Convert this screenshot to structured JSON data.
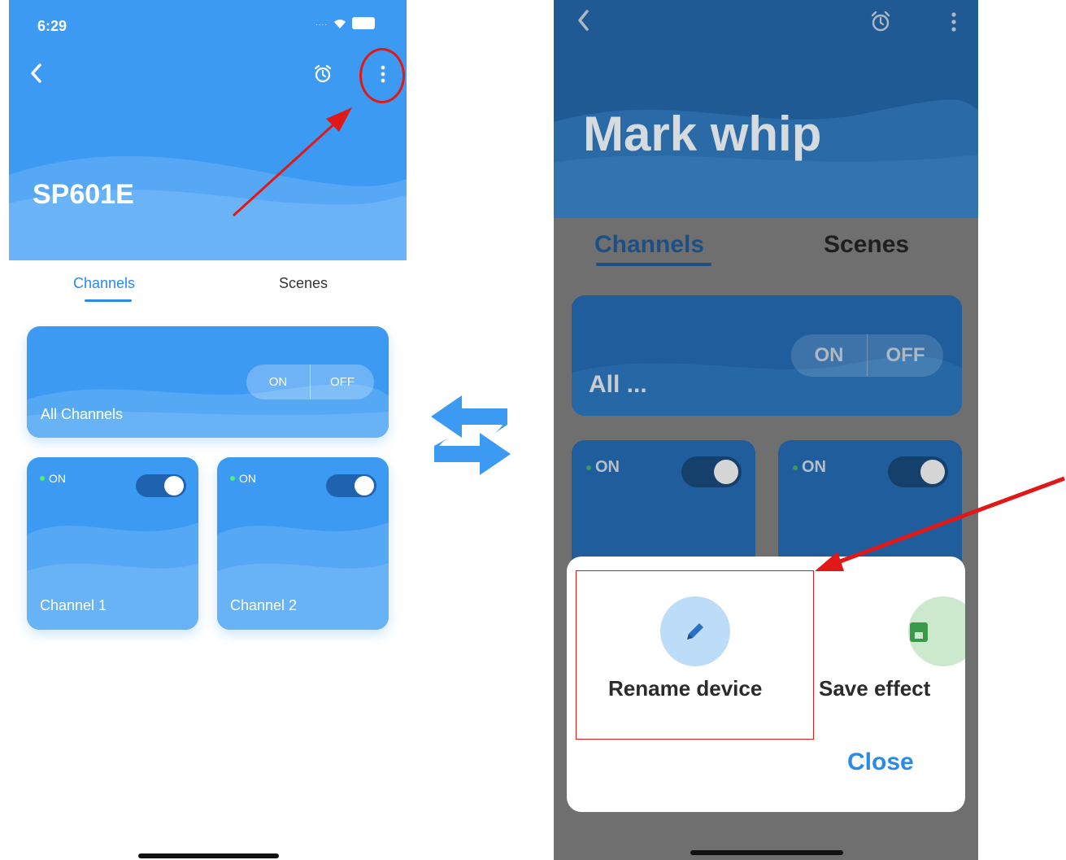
{
  "left": {
    "status": {
      "time": "6:29",
      "signal_dots": "...."
    },
    "header": {
      "device_name": "SP601E"
    },
    "tabs": [
      {
        "label": "Channels",
        "active": true
      },
      {
        "label": "Scenes",
        "active": false
      }
    ],
    "all_channels": {
      "label": "All Channels",
      "on_label": "ON",
      "off_label": "OFF"
    },
    "channels": [
      {
        "label": "Channel 1",
        "status": "ON",
        "enabled": true
      },
      {
        "label": "Channel 2",
        "status": "ON",
        "enabled": true
      }
    ]
  },
  "right": {
    "header": {
      "device_name": "Mark whip"
    },
    "tabs": [
      {
        "label": "Channels",
        "active": true
      },
      {
        "label": "Scenes",
        "active": false
      }
    ],
    "all_channels": {
      "label": "All ...",
      "on_label": "ON",
      "off_label": "OFF"
    },
    "channels": [
      {
        "status": "ON",
        "enabled": true
      },
      {
        "status": "ON",
        "enabled": true
      }
    ],
    "sheet": {
      "actions": [
        {
          "label": "Rename device",
          "icon": "pencil-icon"
        },
        {
          "label": "Save effect",
          "icon": "save-icon"
        }
      ],
      "close_label": "Close"
    }
  },
  "colors": {
    "brand_blue": "#3c9af2",
    "highlight_red": "#e01818",
    "overlay": "#6f6f6f"
  }
}
